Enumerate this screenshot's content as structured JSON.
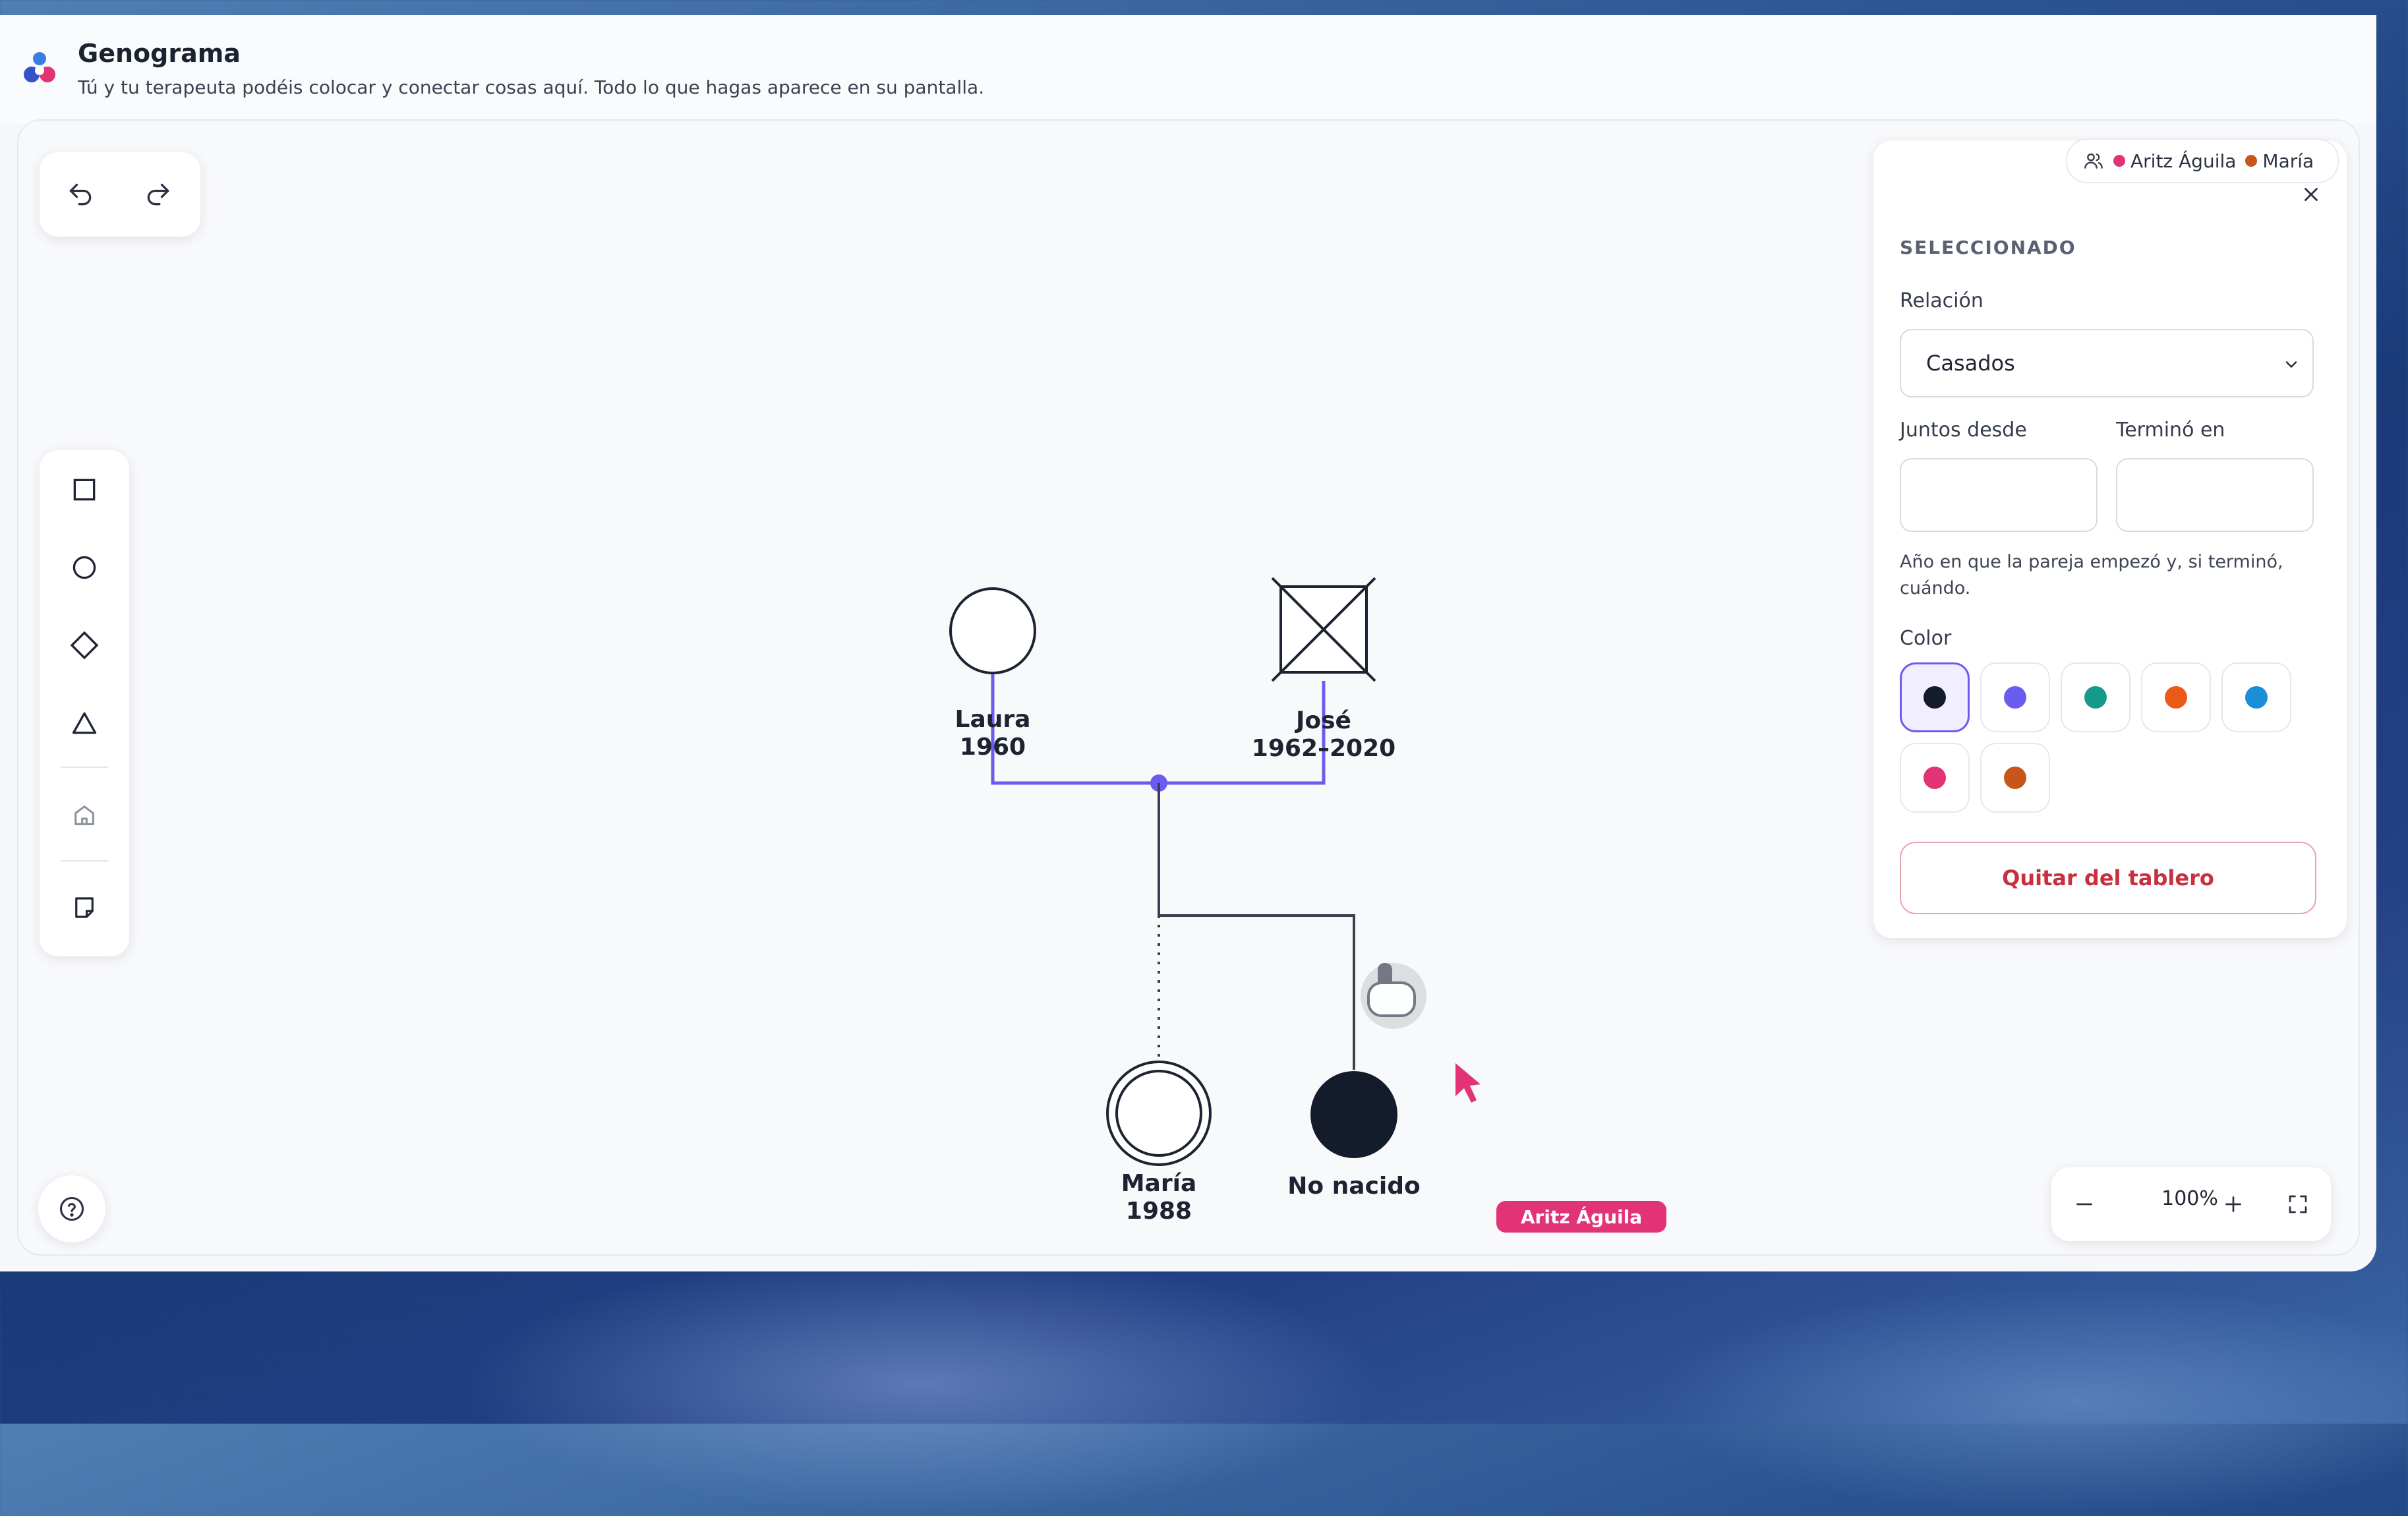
{
  "header": {
    "title": "Genograma",
    "subtitle": "Tú y tu terapeuta podéis colocar y conectar cosas aquí. Todo lo que hagas aparece en su pantalla."
  },
  "presence": {
    "users": [
      {
        "name": "Aritz Águila",
        "color": "#e23376"
      },
      {
        "name": "María",
        "color": "#c8561a"
      }
    ]
  },
  "panel": {
    "section_title": "SELECCIONADO",
    "relation_label": "Relación",
    "relation_value": "Casados",
    "together_since_label": "Juntos desde",
    "together_since_value": "",
    "ended_label": "Terminó en",
    "ended_value": "",
    "help": "Año en que la pareja empezó y, si terminó, cuándo.",
    "color_label": "Color",
    "colors": [
      "#141b2b",
      "#6b5cf0",
      "#159a8c",
      "#ea5a18",
      "#1a8fd6",
      "#e23376",
      "#c8561a"
    ],
    "selected_color": "#141b2b",
    "remove_label": "Quitar del tablero"
  },
  "genogram": {
    "people": [
      {
        "name": "Laura",
        "years": "1960"
      },
      {
        "name": "José",
        "years": "1962–2020"
      },
      {
        "name": "María",
        "years": "1988"
      },
      {
        "name": "No nacido",
        "years": ""
      }
    ],
    "relation_color": "#6b5cf0"
  },
  "zoom": {
    "level": "100%"
  },
  "cursor": {
    "user": "Aritz Águila",
    "color": "#e23376"
  }
}
